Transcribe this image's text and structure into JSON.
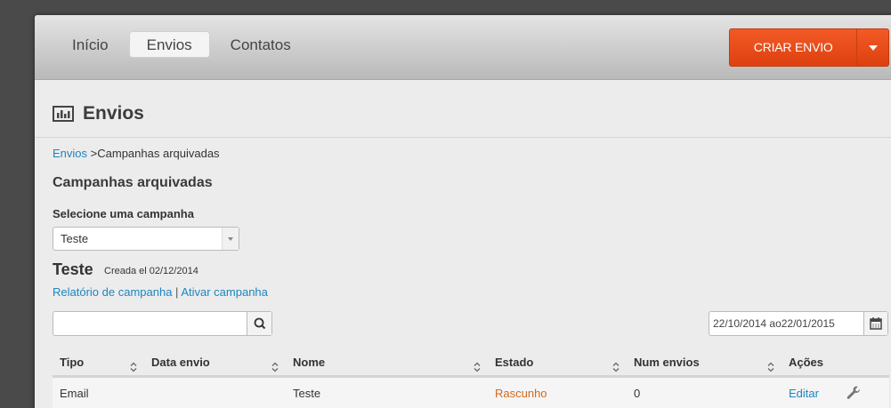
{
  "nav": {
    "items": [
      {
        "label": "Início",
        "active": false
      },
      {
        "label": "Envios",
        "active": true
      },
      {
        "label": "Contatos",
        "active": false
      }
    ]
  },
  "cta": {
    "label": "CRIAR ENVIO"
  },
  "page": {
    "title": "Envios"
  },
  "breadcrumb": {
    "root": "Envios",
    "separator": ">",
    "current": "Campanhas arquivadas"
  },
  "section": {
    "title": "Campanhas arquivadas"
  },
  "campaign_select": {
    "label": "Selecione uma campanha",
    "value": "Teste"
  },
  "campaign": {
    "name": "Teste",
    "created": "Creada el 02/12/2014",
    "report_link": "Relatório de campanha",
    "separator": "|",
    "activate_link": "Ativar campanha"
  },
  "search": {
    "value": "",
    "placeholder": ""
  },
  "date_range": {
    "value": "22/10/2014 ao22/01/2015"
  },
  "table": {
    "columns": [
      "Tipo",
      "Data envio",
      "Nome",
      "Estado",
      "Num envios",
      "Ações"
    ],
    "rows": [
      {
        "tipo": "Email",
        "data_envio": "",
        "nome": "Teste",
        "estado": "Rascunho",
        "num_envios": "0",
        "acao": "Editar"
      }
    ]
  },
  "colors": {
    "accent": "#e84a17",
    "link": "#1a86c0",
    "status_draft": "#d2691e"
  }
}
